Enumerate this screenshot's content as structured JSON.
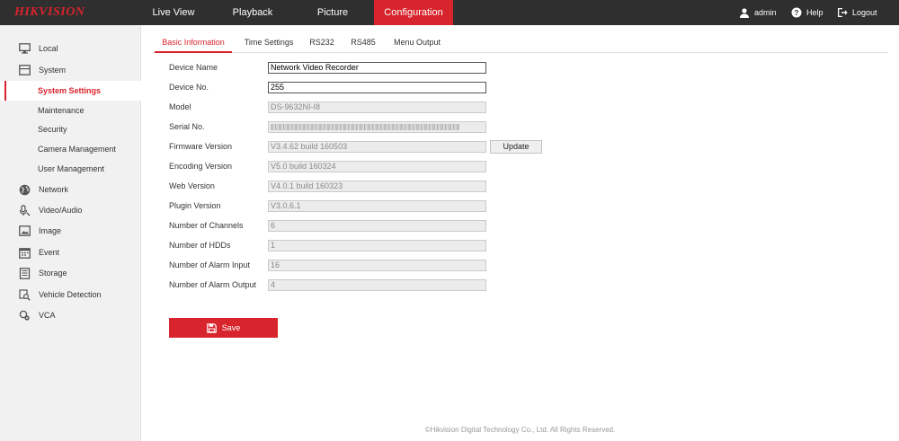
{
  "app": {
    "logo": "HIKVISION",
    "brand_color": "#d8242c"
  },
  "topnav": {
    "items": [
      {
        "label": "Live View"
      },
      {
        "label": "Playback"
      },
      {
        "label": "Picture"
      },
      {
        "label": "Configuration",
        "active": true
      }
    ],
    "user": {
      "label": "admin",
      "icon": "user-icon"
    },
    "help": {
      "label": "Help",
      "icon": "help-icon"
    },
    "logout": {
      "label": "Logout",
      "icon": "logout-icon"
    }
  },
  "sidebar": {
    "items": [
      {
        "label": "Local",
        "icon": "monitor-icon"
      },
      {
        "label": "System",
        "icon": "system-icon"
      },
      {
        "label": "System Settings",
        "sub": true,
        "selected": true
      },
      {
        "label": "Maintenance",
        "sub": true
      },
      {
        "label": "Security",
        "sub": true
      },
      {
        "label": "Camera Management",
        "sub": true
      },
      {
        "label": "User Management",
        "sub": true
      },
      {
        "label": "Network",
        "icon": "globe-icon"
      },
      {
        "label": "Video/Audio",
        "icon": "microphone-icon"
      },
      {
        "label": "Image",
        "icon": "image-icon"
      },
      {
        "label": "Event",
        "icon": "calendar-icon"
      },
      {
        "label": "Storage",
        "icon": "storage-icon"
      },
      {
        "label": "Vehicle Detection",
        "icon": "vehicle-search-icon"
      },
      {
        "label": "VCA",
        "icon": "vca-icon"
      }
    ]
  },
  "tabs": [
    {
      "label": "Basic Information",
      "active": true
    },
    {
      "label": "Time Settings"
    },
    {
      "label": "RS232"
    },
    {
      "label": "RS485"
    },
    {
      "label": "Menu Output"
    }
  ],
  "form": {
    "device_name": {
      "label": "Device Name",
      "value": "Network Video Recorder"
    },
    "device_no": {
      "label": "Device No.",
      "value": "255"
    },
    "model": {
      "label": "Model",
      "value": "DS-9632NI-I8"
    },
    "serial_no": {
      "label": "Serial No."
    },
    "firmware_version": {
      "label": "Firmware Version",
      "value": "V3.4.62 build 160503"
    },
    "encoding_version": {
      "label": "Encoding Version",
      "value": "V5.0 build 160324"
    },
    "web_version": {
      "label": "Web Version",
      "value": "V4.0.1 build 160323"
    },
    "plugin_version": {
      "label": "Plugin Version",
      "value": "V3.0.6.1"
    },
    "num_channels": {
      "label": "Number of Channels",
      "value": "6"
    },
    "num_hdds": {
      "label": "Number of HDDs",
      "value": "1"
    },
    "num_alarm_input": {
      "label": "Number of Alarm Input",
      "value": "16"
    },
    "num_alarm_output": {
      "label": "Number of Alarm Output",
      "value": "4"
    },
    "update_label": "Update",
    "save_label": "Save"
  },
  "footer": "©Hikvision Digital Technology Co., Ltd. All Rights Reserved."
}
